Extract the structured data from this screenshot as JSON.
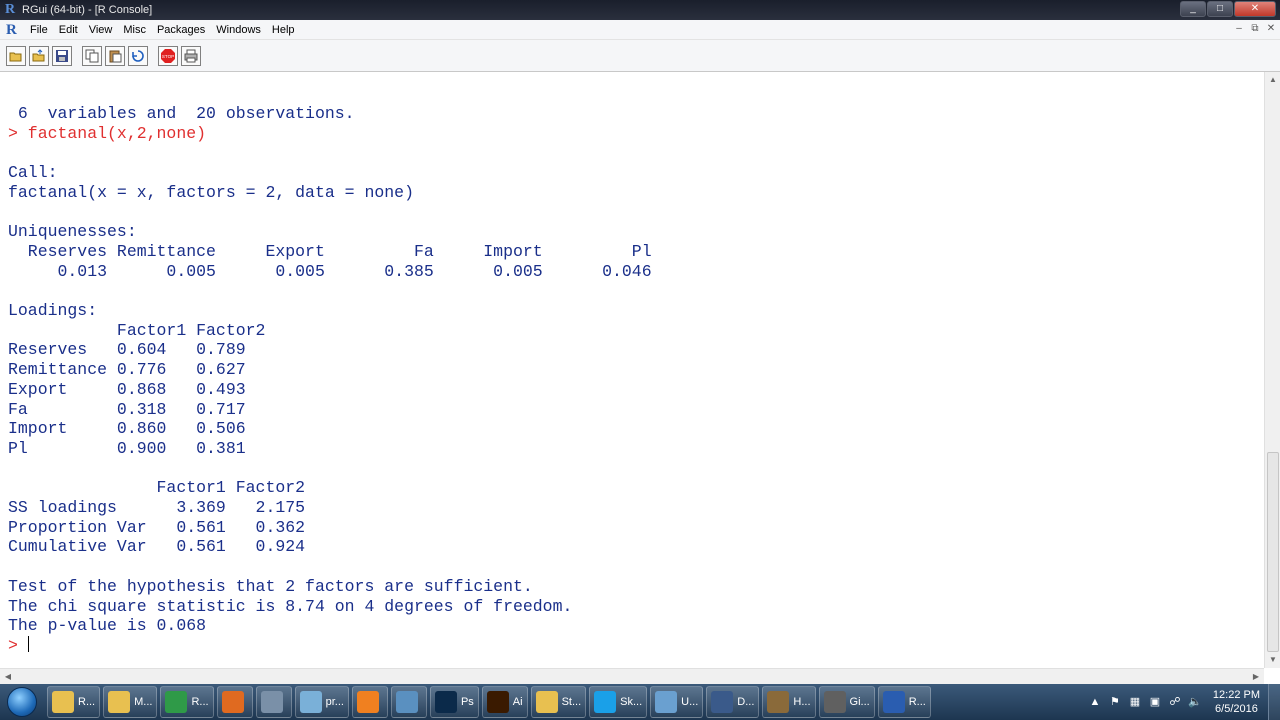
{
  "window": {
    "title": "RGui (64-bit) - [R Console]"
  },
  "menu": {
    "items": [
      "File",
      "Edit",
      "View",
      "Misc",
      "Packages",
      "Windows",
      "Help"
    ]
  },
  "toolbar": {
    "tools": [
      "open-script-icon",
      "load-workspace-icon",
      "save-icon",
      "copy-icon",
      "paste-icon",
      "copy-paste-icon",
      "stop-icon",
      "print-icon"
    ]
  },
  "console": {
    "lines": [
      {
        "text": " 6  variables and  20 observations.",
        "type": "output"
      },
      {
        "text": "> factanal(x,2,none)",
        "type": "command"
      },
      {
        "text": "",
        "type": "output"
      },
      {
        "text": "Call:",
        "type": "output"
      },
      {
        "text": "factanal(x = x, factors = 2, data = none)",
        "type": "output"
      },
      {
        "text": "",
        "type": "output"
      },
      {
        "text": "Uniquenesses:",
        "type": "output"
      },
      {
        "text": "  Reserves Remittance     Export         Fa     Import         Pl",
        "type": "output"
      },
      {
        "text": "     0.013      0.005      0.005      0.385      0.005      0.046",
        "type": "output"
      },
      {
        "text": "",
        "type": "output"
      },
      {
        "text": "Loadings:",
        "type": "output"
      },
      {
        "text": "           Factor1 Factor2",
        "type": "output"
      },
      {
        "text": "Reserves   0.604   0.789",
        "type": "output"
      },
      {
        "text": "Remittance 0.776   0.627",
        "type": "output"
      },
      {
        "text": "Export     0.868   0.493",
        "type": "output"
      },
      {
        "text": "Fa         0.318   0.717",
        "type": "output"
      },
      {
        "text": "Import     0.860   0.506",
        "type": "output"
      },
      {
        "text": "Pl         0.900   0.381",
        "type": "output"
      },
      {
        "text": "",
        "type": "output"
      },
      {
        "text": "               Factor1 Factor2",
        "type": "output"
      },
      {
        "text": "SS loadings      3.369   2.175",
        "type": "output"
      },
      {
        "text": "Proportion Var   0.561   0.362",
        "type": "output"
      },
      {
        "text": "Cumulative Var   0.561   0.924",
        "type": "output"
      },
      {
        "text": "",
        "type": "output"
      },
      {
        "text": "Test of the hypothesis that 2 factors are sufficient.",
        "type": "output"
      },
      {
        "text": "The chi square statistic is 8.74 on 4 degrees of freedom.",
        "type": "output"
      },
      {
        "text": "The p-value is 0.068",
        "type": "output"
      }
    ],
    "prompt": "> "
  },
  "taskbar": {
    "tasks": [
      {
        "label": "R...",
        "icon": "folder-icon",
        "color": "#e8c050"
      },
      {
        "label": "M...",
        "icon": "folder-icon",
        "color": "#e8c050"
      },
      {
        "label": "R...",
        "icon": "chrome-icon",
        "color": "#2f9a48"
      },
      {
        "label": "",
        "icon": "firefox-icon",
        "color": "#e06a20"
      },
      {
        "label": "",
        "icon": "calculator-icon",
        "color": "#7a90a8"
      },
      {
        "label": "pr...",
        "icon": "notepad-icon",
        "color": "#7ab0d8"
      },
      {
        "label": "",
        "icon": "blender-icon",
        "color": "#f08020"
      },
      {
        "label": "",
        "icon": "book-icon",
        "color": "#5a90c0"
      },
      {
        "label": "Ps",
        "icon": "photoshop-icon",
        "color": "#0b2a4a"
      },
      {
        "label": "Ai",
        "icon": "illustrator-icon",
        "color": "#3a1a00"
      },
      {
        "label": "St...",
        "icon": "folder-icon",
        "color": "#e8c050"
      },
      {
        "label": "Sk...",
        "icon": "skype-icon",
        "color": "#1aa0e8"
      },
      {
        "label": "U...",
        "icon": "paint-icon",
        "color": "#6aa0d0"
      },
      {
        "label": "D...",
        "icon": "document-icon",
        "color": "#3a5a8a"
      },
      {
        "label": "H...",
        "icon": "game-icon",
        "color": "#8a6a3a"
      },
      {
        "label": "Gi...",
        "icon": "settings-icon",
        "color": "#606060"
      },
      {
        "label": "R...",
        "icon": "r-icon",
        "color": "#2a5db0"
      }
    ],
    "clock": {
      "time": "12:22 PM",
      "date": "6/5/2016"
    }
  }
}
